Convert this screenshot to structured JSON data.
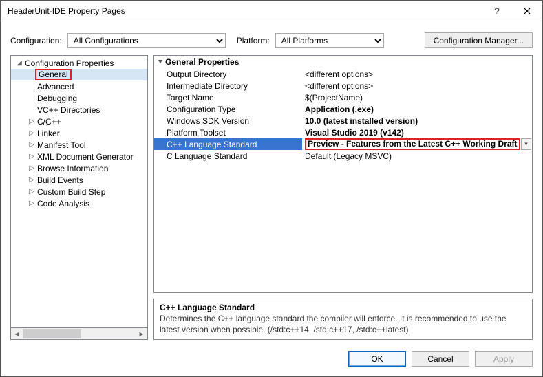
{
  "window": {
    "title": "HeaderUnit-IDE Property Pages"
  },
  "config_row": {
    "config_label": "Configuration:",
    "config_value": "All Configurations",
    "platform_label": "Platform:",
    "platform_value": "All Platforms",
    "manager_button": "Configuration Manager..."
  },
  "tree": {
    "root": "Configuration Properties",
    "items": [
      {
        "label": "General",
        "expandable": false,
        "highlighted": true
      },
      {
        "label": "Advanced",
        "expandable": false
      },
      {
        "label": "Debugging",
        "expandable": false
      },
      {
        "label": "VC++ Directories",
        "expandable": false
      },
      {
        "label": "C/C++",
        "expandable": true
      },
      {
        "label": "Linker",
        "expandable": true
      },
      {
        "label": "Manifest Tool",
        "expandable": true
      },
      {
        "label": "XML Document Generator",
        "expandable": true
      },
      {
        "label": "Browse Information",
        "expandable": true
      },
      {
        "label": "Build Events",
        "expandable": true
      },
      {
        "label": "Custom Build Step",
        "expandable": true
      },
      {
        "label": "Code Analysis",
        "expandable": true
      }
    ]
  },
  "props": {
    "group_title": "General Properties",
    "rows": [
      {
        "name": "Output Directory",
        "value": "<different options>",
        "bold": false
      },
      {
        "name": "Intermediate Directory",
        "value": "<different options>",
        "bold": false
      },
      {
        "name": "Target Name",
        "value": "$(ProjectName)",
        "bold": false
      },
      {
        "name": "Configuration Type",
        "value": "Application (.exe)",
        "bold": true
      },
      {
        "name": "Windows SDK Version",
        "value": "10.0 (latest installed version)",
        "bold": true
      },
      {
        "name": "Platform Toolset",
        "value": "Visual Studio 2019 (v142)",
        "bold": true
      },
      {
        "name": "C++ Language Standard",
        "value": "Preview - Features from the Latest C++ Working Draft",
        "bold": true,
        "selected": true
      },
      {
        "name": "C Language Standard",
        "value": "Default (Legacy MSVC)",
        "bold": false
      }
    ]
  },
  "description": {
    "title": "C++ Language Standard",
    "body": "Determines the C++ language standard the compiler will enforce. It is recommended to use the latest version when possible.  (/std:c++14, /std:c++17, /std:c++latest)"
  },
  "footer": {
    "ok": "OK",
    "cancel": "Cancel",
    "apply": "Apply"
  }
}
